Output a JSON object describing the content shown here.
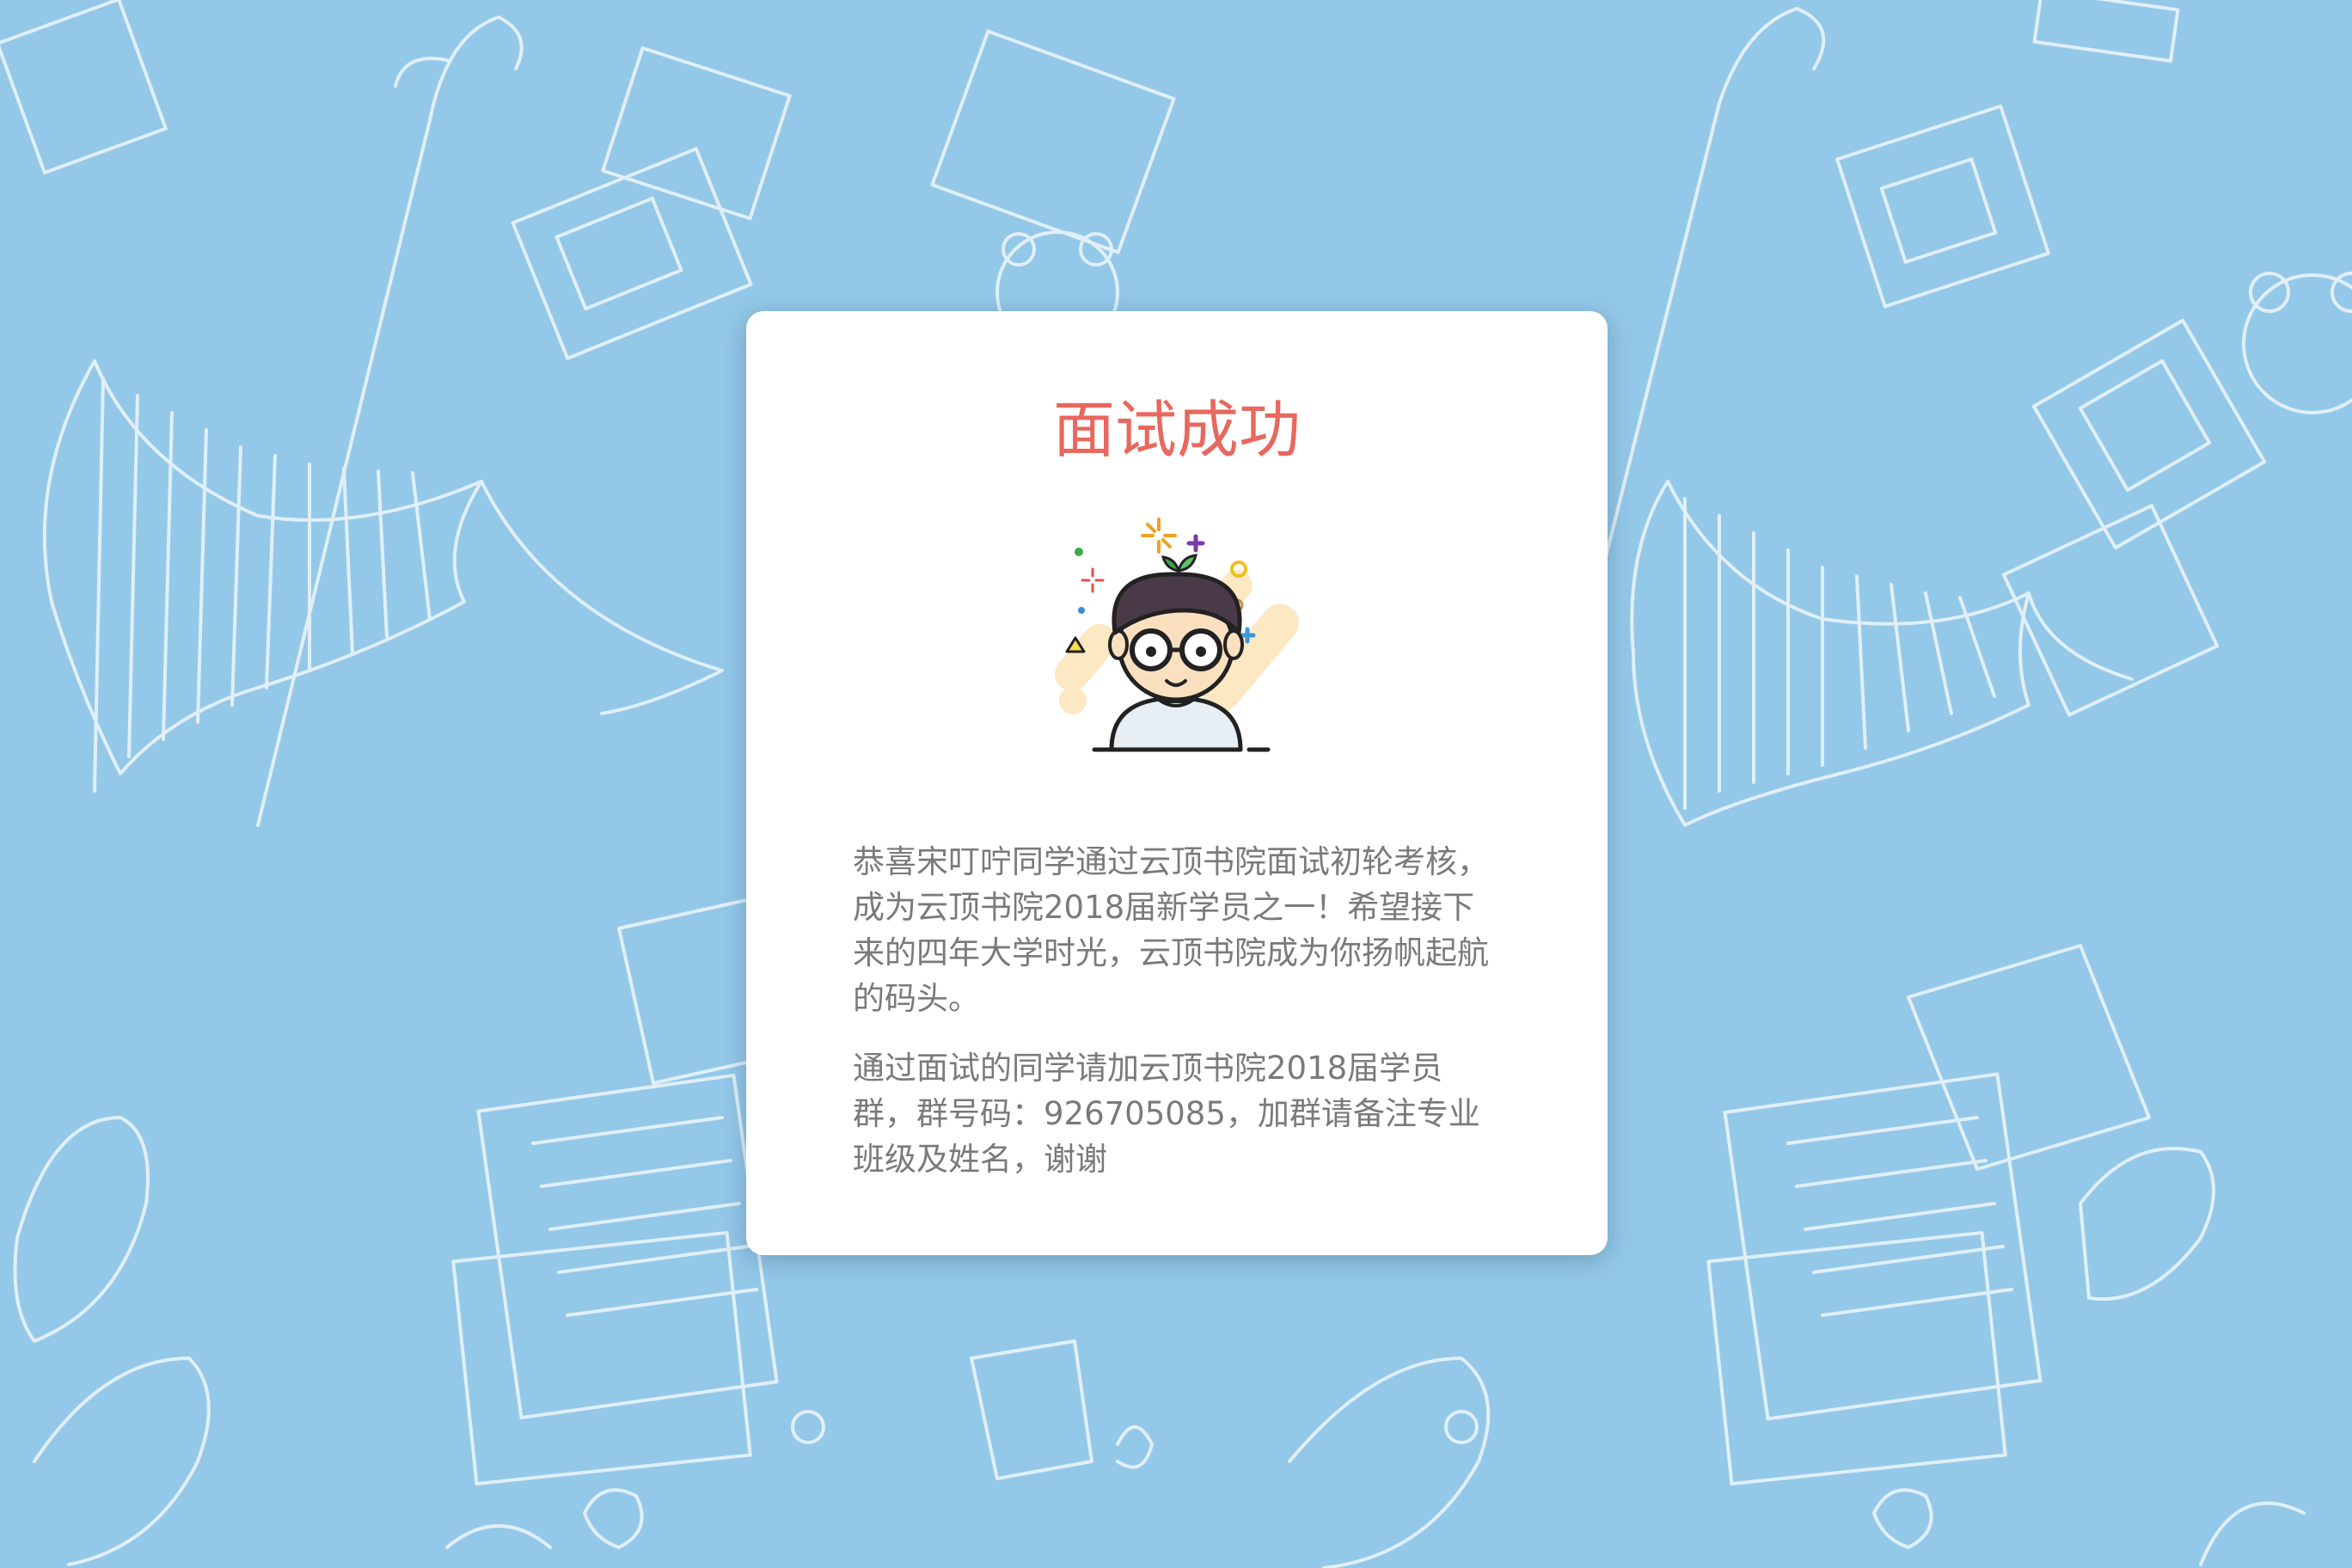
{
  "card": {
    "title": "面试成功",
    "paragraphs": [
      "恭喜宋叮咛同学通过云顶书院面试初轮考核，成为云顶书院2018届新学员之一！希望接下来的四年大学时光，云顶书院成为你扬帆起航的码头。",
      "通过面试的同学请加云顶书院2018届学员群，群号码：926705085，加群请备注专业班级及姓名，谢谢"
    ]
  },
  "colors": {
    "background": "#94c8e8",
    "title": "#e8685e",
    "text": "#7a7a7a",
    "card": "#ffffff"
  },
  "illustration": {
    "background_doodles": "umbrella-sketch, books, notebooks, sneakers, teddy-bear",
    "avatar": "boy-with-glasses-icon"
  }
}
